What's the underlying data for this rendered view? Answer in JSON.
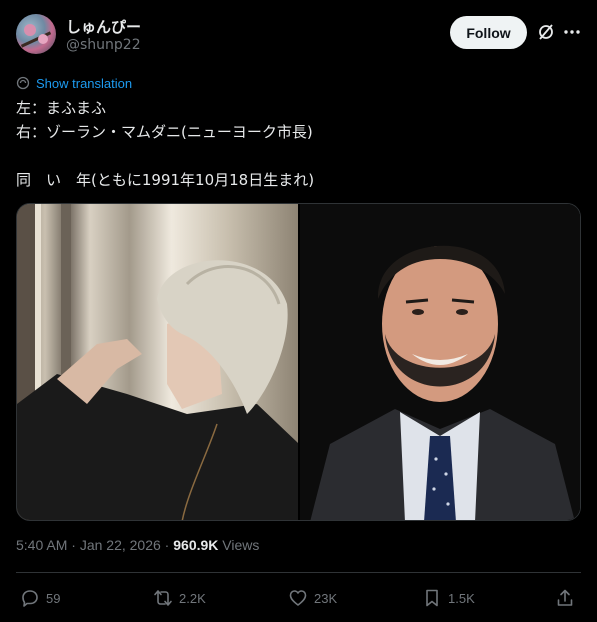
{
  "author": {
    "display_name": "しゅんぴー",
    "handle": "@shunp22"
  },
  "follow_label": "Follow",
  "translate_label": "Show translation",
  "tweet_lines": [
    "左：まふまふ",
    "右：ゾーラン・マムダニ(ニューヨーク市長)",
    "",
    "同　い　年(ともに1991年10月18日生まれ)"
  ],
  "meta": {
    "time": "5:40 AM",
    "sep1": " · ",
    "date": "Jan 22, 2026",
    "sep2": " · ",
    "views_count": "960.9K",
    "views_label": " Views"
  },
  "actions": {
    "replies": "59",
    "reposts": "2.2K",
    "likes": "23K",
    "bookmarks": "1.5K"
  },
  "icons": {
    "grok": "grok-icon",
    "more": "more-icon",
    "translate": "translate-icon",
    "reply": "reply-icon",
    "repost": "repost-icon",
    "like": "heart-icon",
    "bookmark": "bookmark-icon",
    "share": "share-icon"
  },
  "colors": {
    "background": "#000000",
    "text": "#e7e9ea",
    "muted": "#71767b",
    "link": "#1d9bf0",
    "border": "#2f3336"
  }
}
